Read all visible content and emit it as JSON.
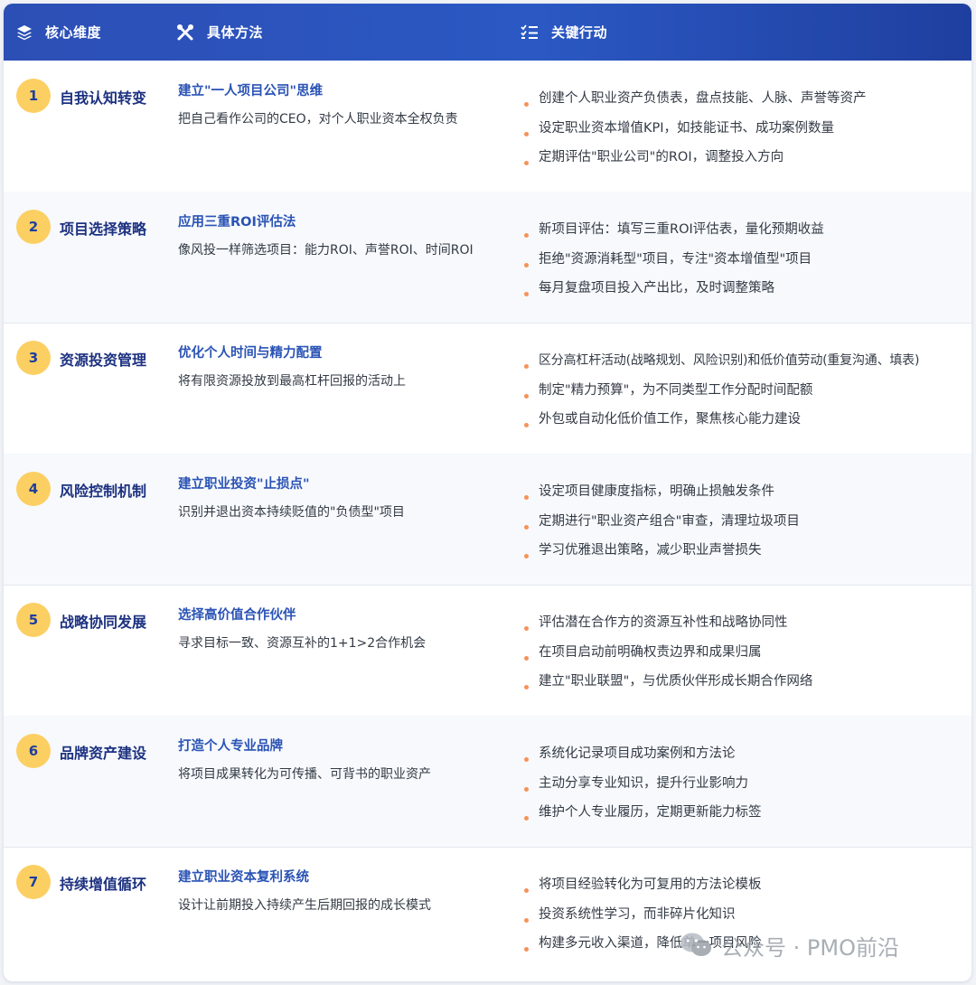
{
  "header": {
    "col1": "核心维度",
    "col2": "具体方法",
    "col3": "关键行动"
  },
  "rows": [
    {
      "num": "1",
      "dimension": "自我认知转变",
      "method_title": "建立\"一人项目公司\"思维",
      "method_desc": "把自己看作公司的CEO，对个人职业资本全权负责",
      "actions": [
        "创建个人职业资产负债表，盘点技能、人脉、声誉等资产",
        "设定职业资本增值KPI，如技能证书、成功案例数量",
        "定期评估\"职业公司\"的ROI，调整投入方向"
      ]
    },
    {
      "num": "2",
      "dimension": "项目选择策略",
      "method_title": "应用三重ROI评估法",
      "method_desc": "像风投一样筛选项目：能力ROI、声誉ROI、时间ROI",
      "actions": [
        "新项目评估：填写三重ROI评估表，量化预期收益",
        "拒绝\"资源消耗型\"项目，专注\"资本增值型\"项目",
        "每月复盘项目投入产出比，及时调整策略"
      ]
    },
    {
      "num": "3",
      "dimension": "资源投资管理",
      "method_title": "优化个人时间与精力配置",
      "method_desc": "将有限资源投放到最高杠杆回报的活动上",
      "actions": [
        "区分高杠杆活动(战略规划、风险识别)和低价值劳动(重复沟通、填表)",
        "制定\"精力预算\"，为不同类型工作分配时间配额",
        "外包或自动化低价值工作，聚焦核心能力建设"
      ]
    },
    {
      "num": "4",
      "dimension": "风险控制机制",
      "method_title": "建立职业投资\"止损点\"",
      "method_desc": "识别并退出资本持续贬值的\"负债型\"项目",
      "actions": [
        "设定项目健康度指标，明确止损触发条件",
        "定期进行\"职业资产组合\"审查，清理垃圾项目",
        "学习优雅退出策略，减少职业声誉损失"
      ]
    },
    {
      "num": "5",
      "dimension": "战略协同发展",
      "method_title": "选择高价值合作伙伴",
      "method_desc": "寻求目标一致、资源互补的1+1>2合作机会",
      "actions": [
        "评估潜在合作方的资源互补性和战略协同性",
        "在项目启动前明确权责边界和成果归属",
        "建立\"职业联盟\"，与优质伙伴形成长期合作网络"
      ]
    },
    {
      "num": "6",
      "dimension": "品牌资产建设",
      "method_title": "打造个人专业品牌",
      "method_desc": "将项目成果转化为可传播、可背书的职业资产",
      "actions": [
        "系统化记录项目成功案例和方法论",
        "主动分享专业知识，提升行业影响力",
        "维护个人专业履历，定期更新能力标签"
      ]
    },
    {
      "num": "7",
      "dimension": "持续增值循环",
      "method_title": "建立职业资本复利系统",
      "method_desc": "设计让前期投入持续产生后期回报的成长模式",
      "actions": [
        "将项目经验转化为可复用的方法论模板",
        "投资系统性学习，而非碎片化知识",
        "构建多元收入渠道，降低单一项目风险"
      ]
    }
  ],
  "watermark": "公众号 · PMO前沿",
  "colors": {
    "header_bg": "#2b58c3",
    "badge": "#fccf63",
    "dimension_text": "#1c3180",
    "method_title": "#2a53b5",
    "bullet": "#f4935a"
  }
}
